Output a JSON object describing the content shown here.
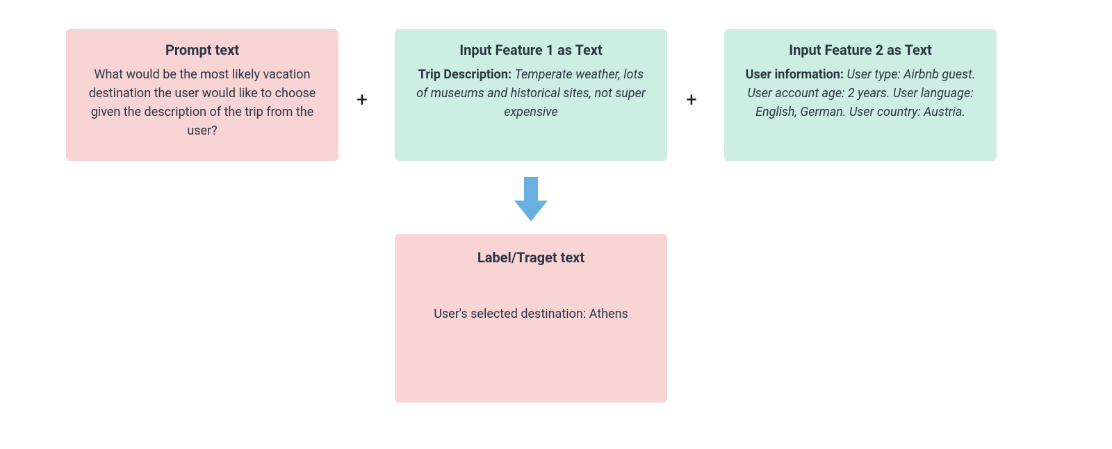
{
  "colors": {
    "pink": "#f8d4d4",
    "teal": "#cdeee3",
    "arrow": "#6aafe1",
    "text": "#2b3544"
  },
  "boxes": {
    "prompt": {
      "title": "Prompt text",
      "body": "What would be the most likely vacation destination the user would like to choose given the description of the trip from the user?"
    },
    "feature1": {
      "title": "Input Feature 1 as Text",
      "label": "Trip Description:",
      "content": "Temperate weather, lots of museums and historical sites, not super expensive"
    },
    "feature2": {
      "title": "Input Feature 2 as Text",
      "label": "User information:",
      "content": "User type: Airbnb guest. User account age: 2 years. User language: English, German. User country: Austria."
    },
    "label": {
      "title": "Label/Traget text",
      "body": "User's selected destination: Athens"
    }
  },
  "connectors": {
    "plus": "+"
  }
}
